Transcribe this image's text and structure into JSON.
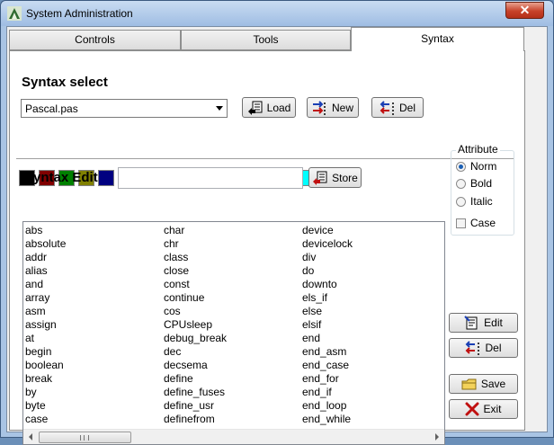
{
  "window": {
    "title": "System Administration",
    "close_glyph": "✕"
  },
  "tabs": [
    {
      "label": "Controls",
      "active": false
    },
    {
      "label": "Tools",
      "active": false
    },
    {
      "label": "Syntax",
      "active": true
    }
  ],
  "syntax_select": {
    "label": "Syntax select",
    "selected": "Pascal.pas",
    "load_label": "Load",
    "new_label": "New",
    "del_label": "Del"
  },
  "palette": [
    "#000000",
    "#800000",
    "#008000",
    "#808000",
    "#000080",
    "#800080",
    "#008080",
    "#c0c0c0",
    "#808080",
    "#ff0000",
    "#00ff00",
    "#ffff00",
    "#0000ff",
    "#ff00ff",
    "#00ffff",
    "#ffffff"
  ],
  "syntax_edit": {
    "label": "Syntax Edit",
    "value": "",
    "store_label": "Store"
  },
  "attribute": {
    "title": "Attribute",
    "norm": "Norm",
    "bold": "Bold",
    "italic": "Italic",
    "case": "Case",
    "selected": "Norm",
    "case_checked": false
  },
  "keywords": {
    "col1": [
      "abs",
      "absolute",
      "addr",
      "alias",
      "and",
      "array",
      "asm",
      "assign",
      "at",
      "begin",
      "boolean",
      "break",
      "by",
      "byte",
      "case"
    ],
    "col2": [
      "char",
      "chr",
      "class",
      "close",
      "const",
      "continue",
      "cos",
      "CPUsleep",
      "debug_break",
      "dec",
      "decsema",
      "define",
      "define_fuses",
      "define_usr",
      "definefrom"
    ],
    "col3": [
      "device",
      "devicelock",
      "div",
      "do",
      "downto",
      "els_if",
      "else",
      "elsif",
      "end",
      "end_asm",
      "end_case",
      "end_for",
      "end_if",
      "end_loop",
      "end_while"
    ]
  },
  "actions": {
    "edit_label": "Edit",
    "del_label": "Del",
    "save_label": "Save",
    "exit_label": "Exit"
  }
}
